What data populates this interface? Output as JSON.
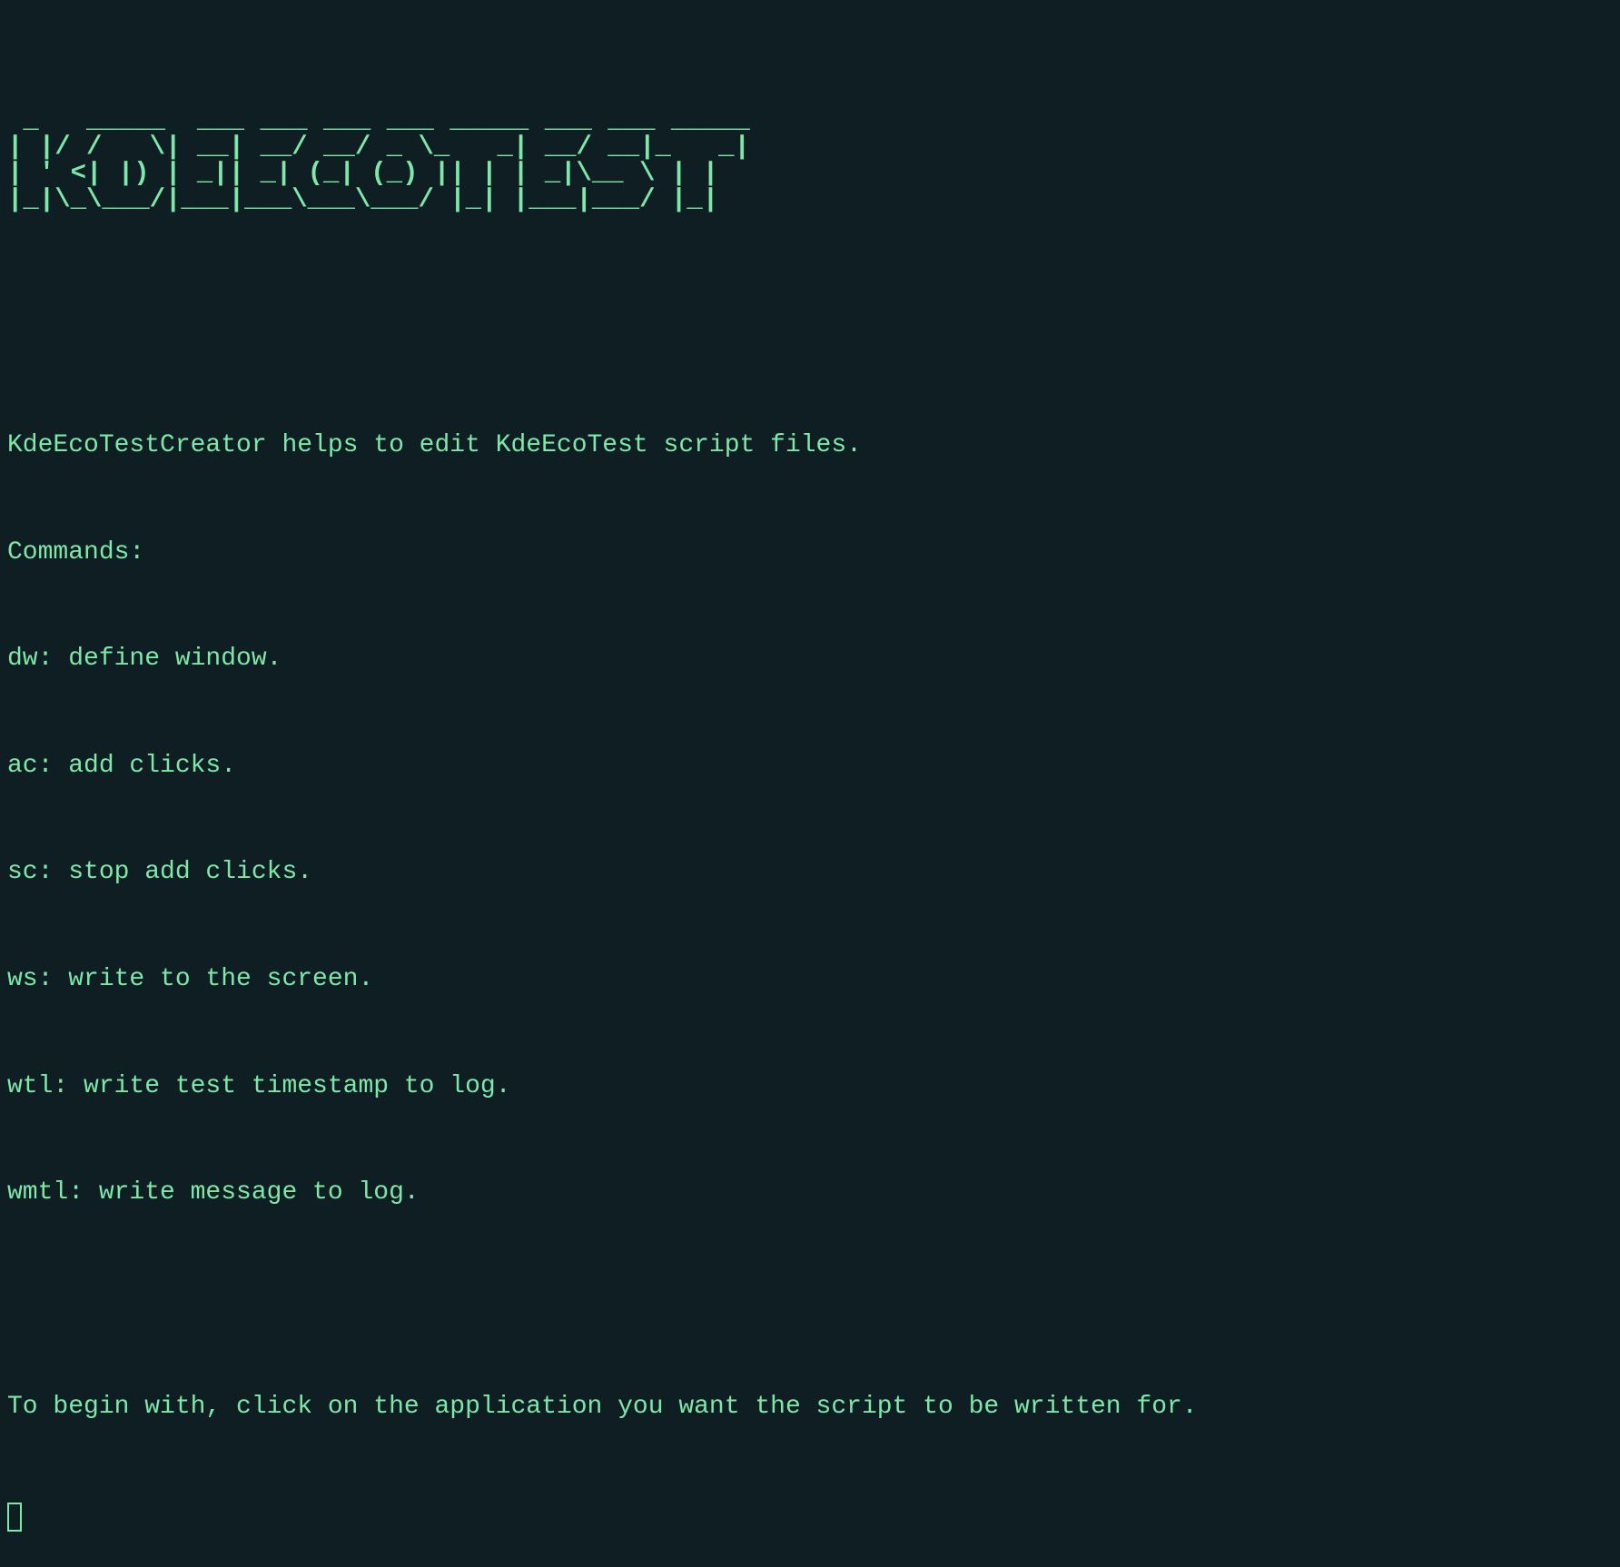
{
  "terminal": {
    "ascii_banner": " _   _____  ___ ___ ___ ___ _____ ___ ___ _____ \n| |/ /   \\| __| __/ __/ _ \\_   _| __/ __|_   _|\n| ' <| |) | _|| _| (_| (_) || | | _|\\__ \\ | |  \n|_|\\_\\___/|___|___\\___\\___/ |_| |___|___/ |_|  ",
    "description": "KdeEcoTestCreator helps to edit KdeEcoTest script files.",
    "commands_header": "Commands:",
    "commands": [
      "dw: define window.",
      "ac: add clicks.",
      "sc: stop add clicks.",
      "ws: write to the screen.",
      "wtl: write test timestamp to log.",
      "wmtl: write message to log."
    ],
    "instruction": "To begin with, click on the application you want the script to be written for."
  }
}
